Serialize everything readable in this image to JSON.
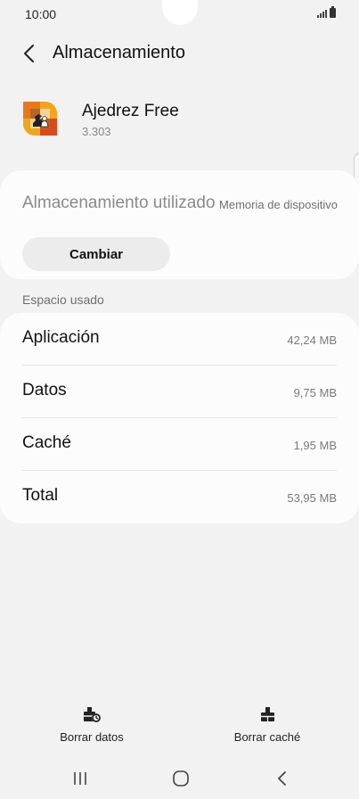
{
  "status": {
    "time": "10:00"
  },
  "header": {
    "title": "Almacenamiento",
    "back_icon": "chevron-left-icon"
  },
  "app": {
    "name": "Ajedrez Free",
    "version": "3.303",
    "icon": "chess-app-icon"
  },
  "storage": {
    "label": "Almacenamiento utilizado",
    "value": "Memoria de dispositivo",
    "change_button": "Cambiar"
  },
  "usage": {
    "section_label": "Espacio usado",
    "rows": [
      {
        "label": "Aplicación",
        "value": "42,24 MB"
      },
      {
        "label": "Datos",
        "value": "9,75 MB"
      },
      {
        "label": "Caché",
        "value": "1,95 MB"
      },
      {
        "label": "Total",
        "value": "53,95 MB"
      }
    ]
  },
  "actions": {
    "clear_data": "Borrar datos",
    "clear_cache": "Borrar caché"
  },
  "colors": {
    "background": "#f2f2f2",
    "card": "#fcfcfc",
    "button": "#ececec"
  }
}
